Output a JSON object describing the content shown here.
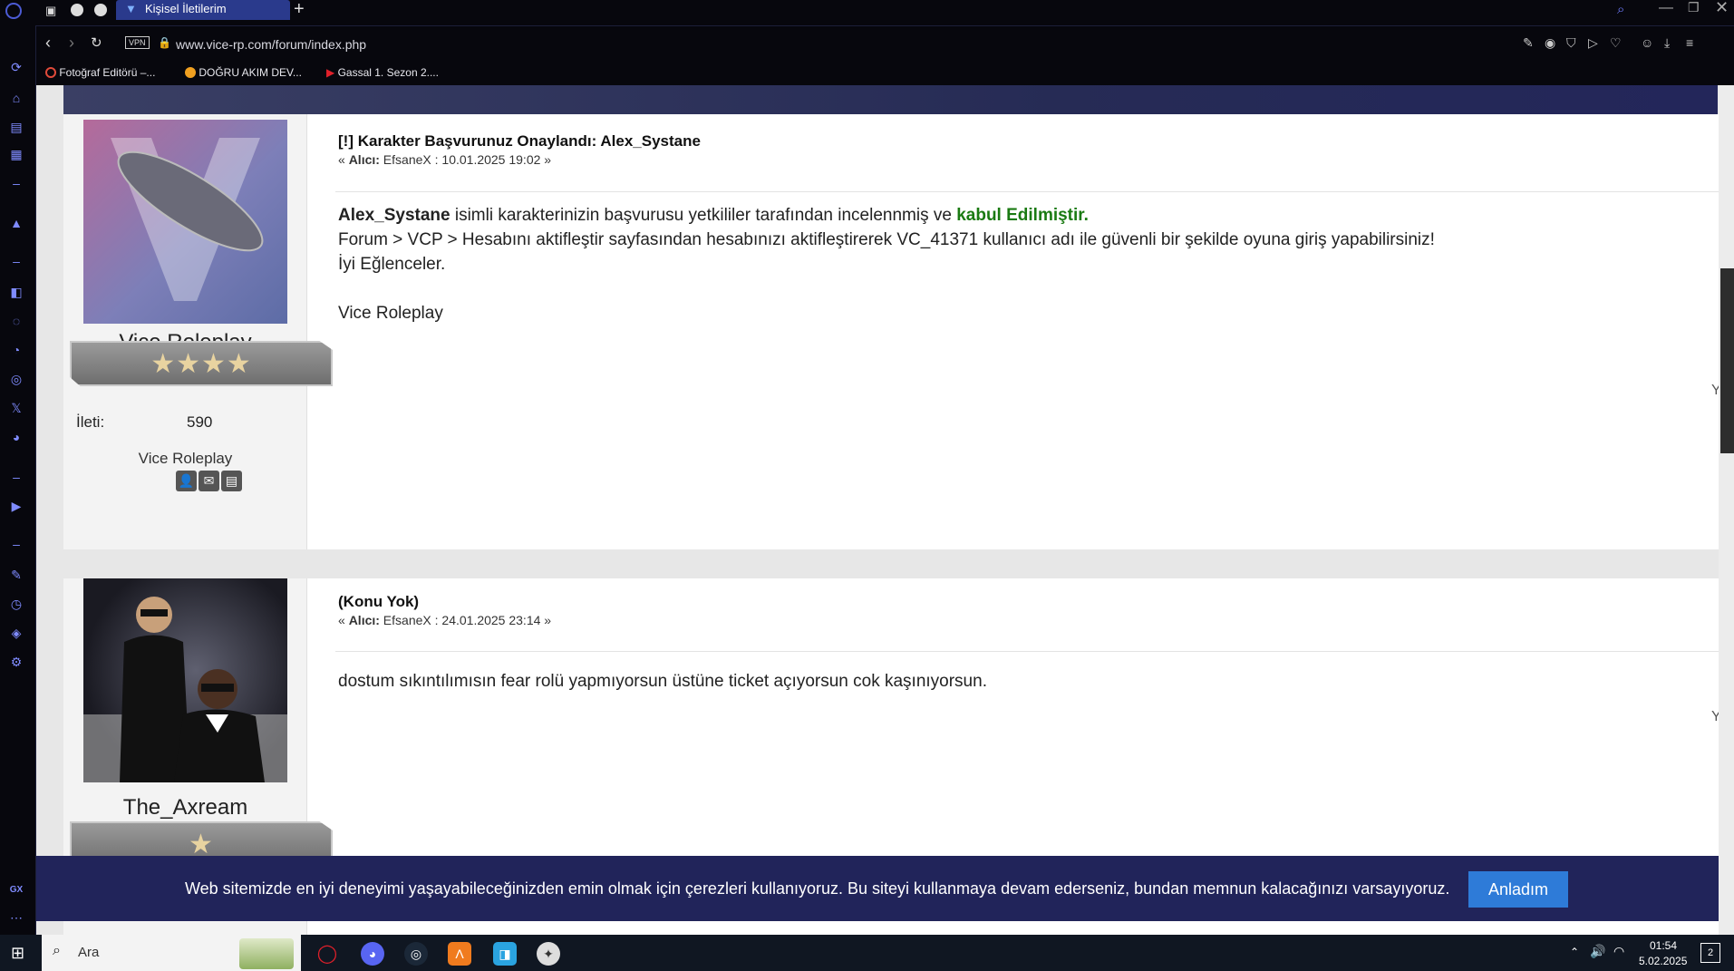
{
  "browser": {
    "tab_title": "Kişisel İletilerim",
    "new_tab": "+",
    "vpn_label": "VPN",
    "url": "www.vice-rp.com/forum/index.php",
    "bookmarks": [
      {
        "label": "Fotoğraf Editörü –...",
        "color": "#e04a3a"
      },
      {
        "label": "DOĞRU AKIM DEV...",
        "color": "#f0a020"
      },
      {
        "label": "Gassal 1. Sezon 2....",
        "color": "#e0202a"
      }
    ],
    "sidebar_footer": "GX"
  },
  "posts": [
    {
      "username": "Vice Roleplay",
      "stars": "★★★★",
      "post_count_label": "İleti:",
      "post_count": "590",
      "rank_text": "Vice Roleplay",
      "subject": "[!] Karakter Başvurunuz Onaylandı: Alex_Systane",
      "meta_prefix": "« ",
      "meta_to_label": "Alıcı:",
      "meta_rest": " EfsaneX : 10.01.2025 19:02 »",
      "line1_name": "Alex_Systane",
      "line1_mid": " isimli karakterinizin başvurusu yetkililer tarafından incelennmiş ve ",
      "line1_green": "kabul Edilmiştir.",
      "line2": "Forum > VCP > Hesabını aktifleştir sayfasından hesabınızı aktifleştirerek VC_41371 kullanıcı adı ile güvenli bir şekilde oyuna giriş yapabilirsiniz!",
      "line3": "İyi Eğlenceler.",
      "signature": "Vice Roleplay",
      "edge_char": "Y"
    },
    {
      "username": "The_Axream",
      "stars": "★",
      "subject": "(Konu Yok)",
      "meta_prefix": "« ",
      "meta_to_label": "Alıcı:",
      "meta_rest": " EfsaneX : 24.01.2025 23:14 »",
      "body": "dostum sıkıntılımısın fear rolü yapmıyorsun üstüne ticket açıyorsun cok kaşınıyorsun.",
      "edge_char": "Y"
    }
  ],
  "cookie": {
    "text": "Web sitemizde en iyi deneyimi yaşayabileceğinizden emin olmak için çerezleri kullanıyoruz. Bu siteyi kullanmaya devam ederseniz, bundan memnun kalacağınızı varsayıyoruz.",
    "button": "Anladım"
  },
  "taskbar": {
    "search_placeholder": "Ara",
    "time": "01:54",
    "date": "5.02.2025",
    "notification_count": "2"
  }
}
